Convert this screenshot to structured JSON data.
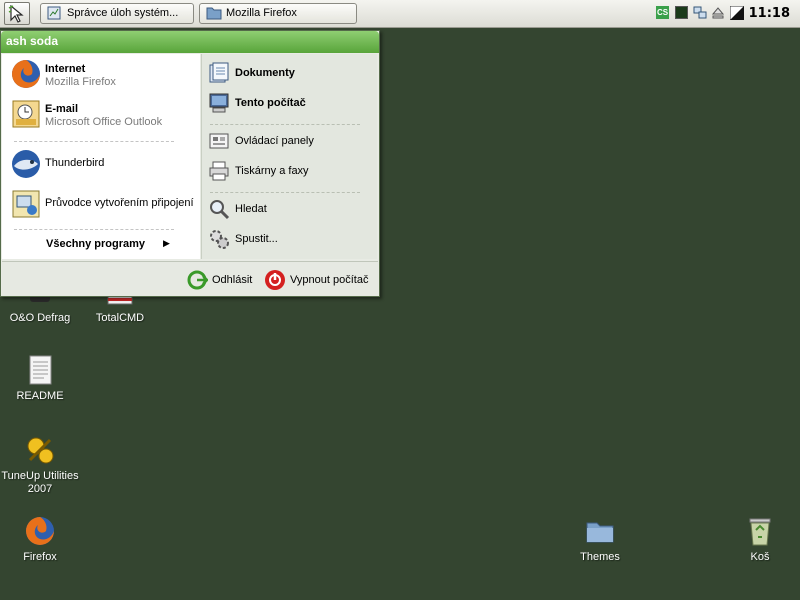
{
  "taskbar": {
    "tasks": [
      {
        "label": "Správce úloh systém...",
        "icon": "task-manager-icon"
      },
      {
        "label": "Mozilla Firefox",
        "icon": "folder-icon"
      }
    ],
    "clock": "11:18",
    "tray_icons": [
      "cs-language-icon",
      "cpu-monitor-icon",
      "network-icon",
      "eject-icon",
      "volume-icon"
    ]
  },
  "start_menu": {
    "user": "ash soda",
    "pinned": [
      {
        "title": "Internet",
        "subtitle": "Mozilla Firefox",
        "icon": "firefox-icon"
      },
      {
        "title": "E-mail",
        "subtitle": "Microsoft Office Outlook",
        "icon": "outlook-icon"
      }
    ],
    "recent": [
      {
        "title": "Thunderbird",
        "icon": "thunderbird-icon"
      },
      {
        "title": "Průvodce vytvořením připojení",
        "icon": "connection-wizard-icon"
      }
    ],
    "all_programs": "Všechny programy",
    "places": [
      {
        "label": "Dokumenty",
        "icon": "documents-icon"
      },
      {
        "label": "Tento počítač",
        "icon": "computer-icon"
      },
      {
        "label": "Ovládací panely",
        "icon": "control-panel-icon"
      },
      {
        "label": "Tiskárny a faxy",
        "icon": "printer-icon"
      },
      {
        "label": "Hledat",
        "icon": "search-icon"
      },
      {
        "label": "Spustit...",
        "icon": "run-icon"
      }
    ],
    "logoff": "Odhlásit",
    "shutdown": "Vypnout počítač"
  },
  "desktop": {
    "icons": [
      {
        "label": "O&O Defrag",
        "icon": "defrag-icon"
      },
      {
        "label": "TotalCMD",
        "icon": "totalcmd-icon"
      },
      {
        "label": "README",
        "icon": "text-document-icon"
      },
      {
        "label": "TuneUp Utilities 2007",
        "icon": "tuneup-icon"
      },
      {
        "label": "Firefox",
        "icon": "firefox-icon"
      },
      {
        "label": "Themes",
        "icon": "folder-icon"
      },
      {
        "label": "Koš",
        "icon": "recycle-bin-icon"
      }
    ]
  },
  "colors": {
    "desktop": "#344530",
    "menu_header": "#58a43a",
    "shutdown": "#d42020"
  }
}
